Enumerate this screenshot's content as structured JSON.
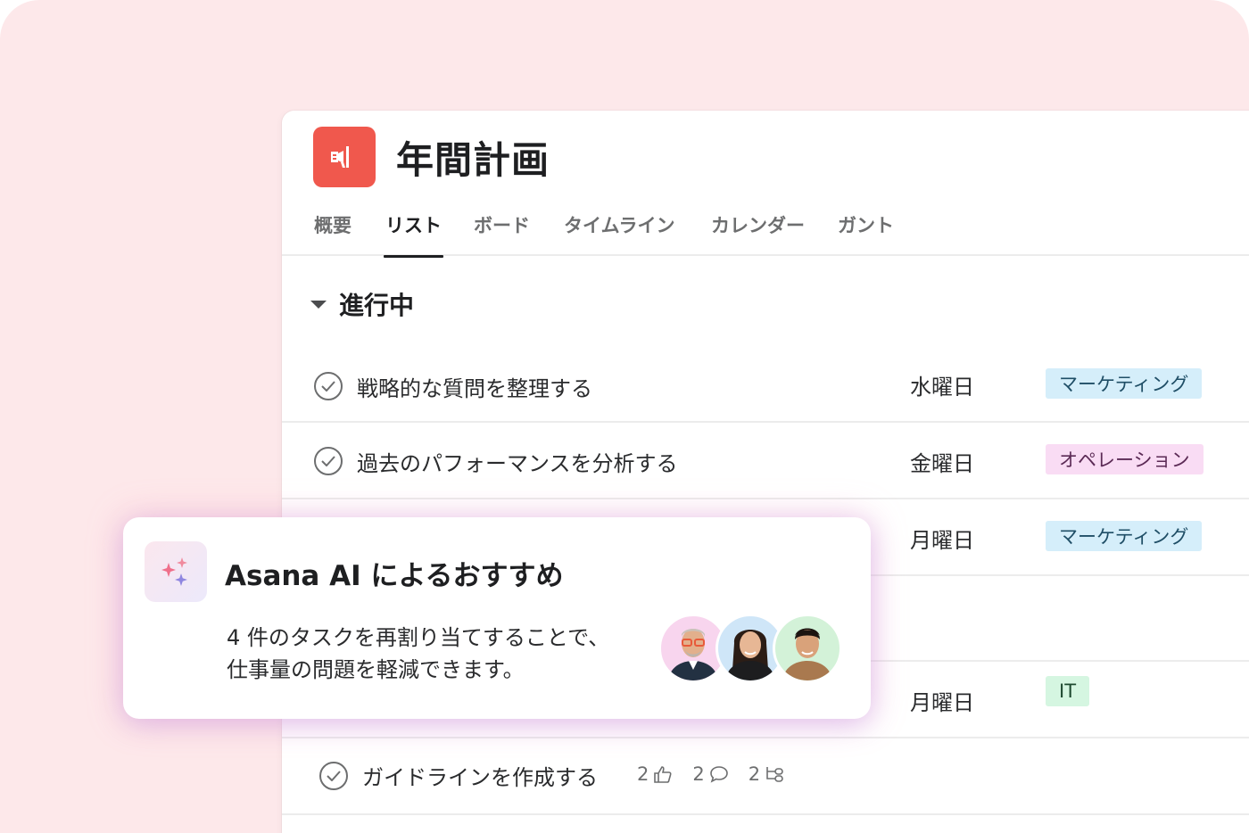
{
  "project": {
    "title": "年間計画",
    "icon": "megaphone-icon",
    "accent": "#f0584d"
  },
  "tabs": [
    {
      "label": "概要"
    },
    {
      "label": "リスト",
      "active": true
    },
    {
      "label": "ボード"
    },
    {
      "label": "タイムライン"
    },
    {
      "label": "カレンダー"
    },
    {
      "label": "ガント"
    }
  ],
  "section": {
    "label": "進行中"
  },
  "tasks": [
    {
      "name": "戦略的な質問を整理する",
      "due": "水曜日",
      "tag": "マーケティング",
      "tag_bg": "#d5eefa",
      "tag_fg": "#1f4e66"
    },
    {
      "name": "過去のパフォーマンスを分析する",
      "due": "金曜日",
      "tag": "オペレーション",
      "tag_bg": "#f9dcf4",
      "tag_fg": "#5b2a55"
    },
    {
      "name": "",
      "due": "月曜日",
      "tag": "マーケティング",
      "tag_bg": "#d5eefa",
      "tag_fg": "#1f4e66"
    },
    {
      "name": "",
      "due": "",
      "tag": ""
    },
    {
      "name": "",
      "due": "月曜日",
      "tag": "IT",
      "tag_bg": "#d5f6e1",
      "tag_fg": "#1e4a30"
    },
    {
      "name": "ガイドラインを作成する",
      "likes": "2",
      "comments": "2",
      "subtasks": "2"
    }
  ],
  "ai_card": {
    "title": "Asana AI によるおすすめ",
    "line1": "4 件のタスクを再割り当てすることで、",
    "line2": "仕事量の問題を軽減できます。",
    "icon": "sparkles-icon"
  },
  "avatars": [
    {
      "name": "avatar-man-glasses",
      "bg": "#f8d5ee"
    },
    {
      "name": "avatar-woman",
      "bg": "#cfe6f8"
    },
    {
      "name": "avatar-man",
      "bg": "#d3f2d8"
    }
  ]
}
